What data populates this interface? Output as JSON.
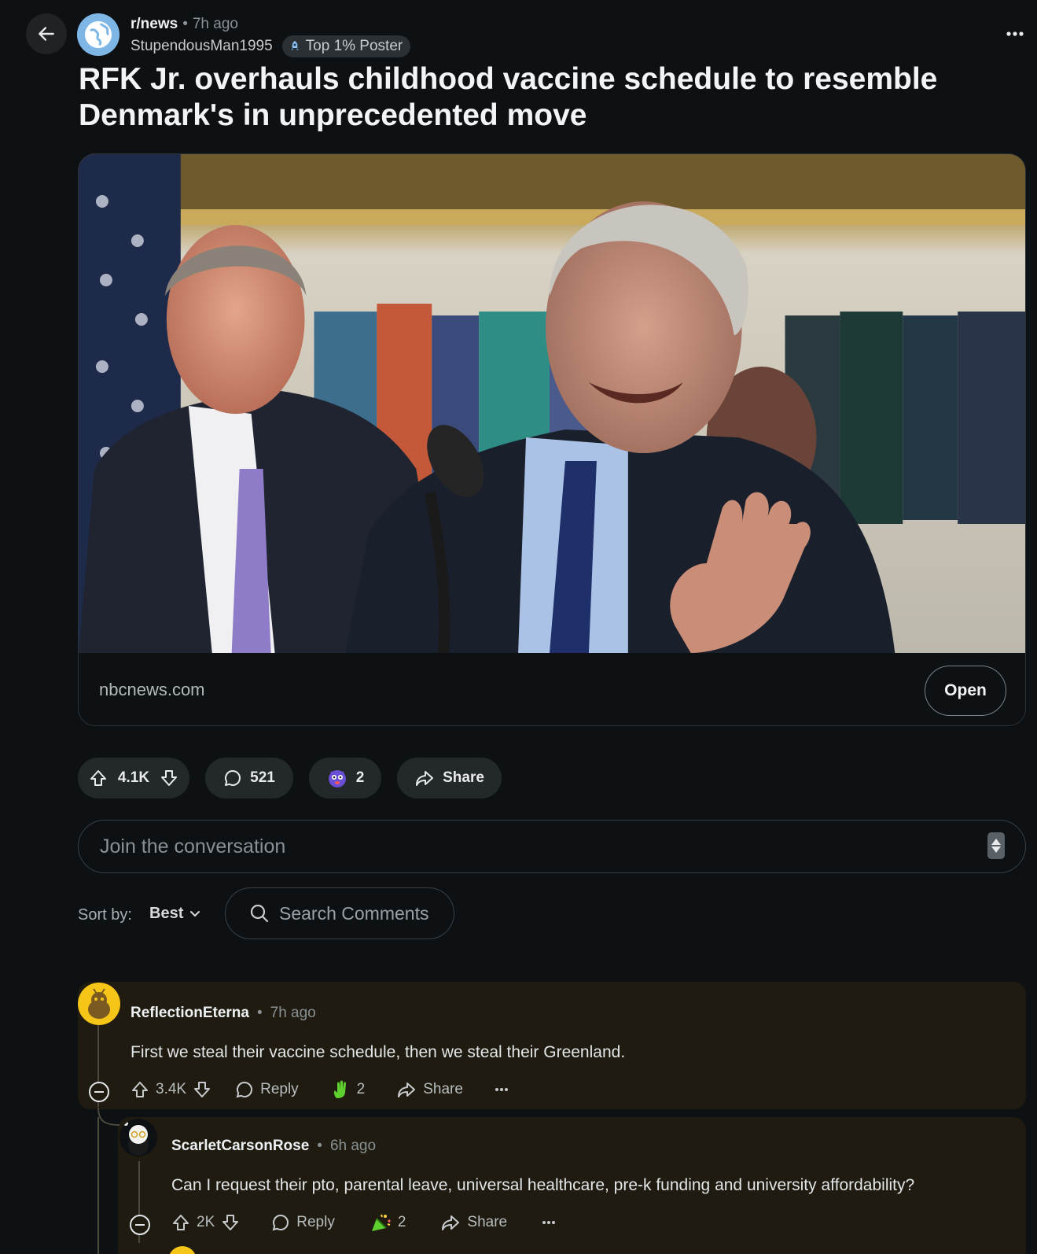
{
  "header": {
    "subreddit": "r/news",
    "post_time": "7h ago",
    "author": "StupendousMan1995",
    "flair": "Top 1% Poster"
  },
  "post": {
    "title": "RFK Jr. overhauls childhood vaccine schedule to resemble Denmark's in unprecedented move",
    "domain": "nbcnews.com",
    "open_label": "Open",
    "score": "4.1K",
    "comment_count": "521",
    "award_count": "2",
    "share_label": "Share"
  },
  "composer": {
    "placeholder": "Join the conversation"
  },
  "sort": {
    "label": "Sort by:",
    "value": "Best"
  },
  "search": {
    "placeholder": "Search Comments"
  },
  "comments": [
    {
      "author": "ReflectionEterna",
      "time": "7h ago",
      "body": "First we steal their vaccine schedule, then we steal their Greenland.",
      "score": "3.4K",
      "reply_label": "Reply",
      "award_count": "2",
      "share_label": "Share"
    },
    {
      "author": "ScarletCarsonRose",
      "time": "6h ago",
      "body": "Can I request their pto, parental leave, universal healthcare, pre-k funding and university affordability?",
      "score": "2K",
      "reply_label": "Reply",
      "award_count": "2",
      "share_label": "Share"
    }
  ],
  "colors": {
    "background": "#0e1113",
    "pill": "#23282b",
    "comment_highlight": "#1f1b10",
    "text": "#d7dadc"
  }
}
